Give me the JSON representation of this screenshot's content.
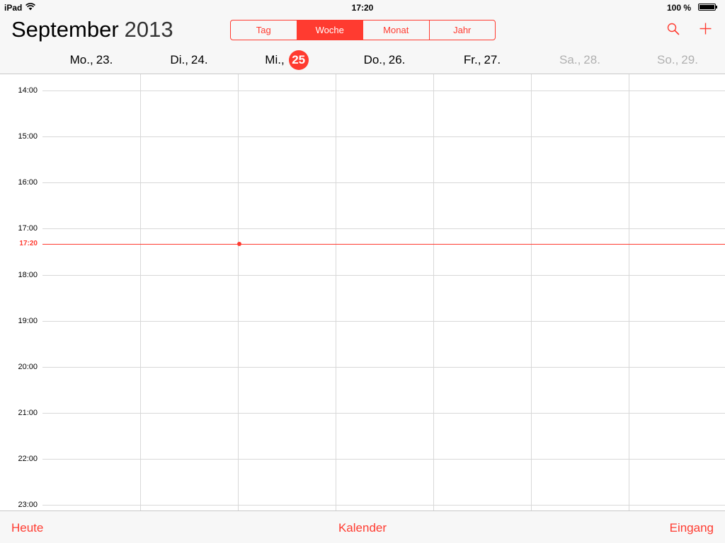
{
  "status_bar": {
    "device": "iPad",
    "time": "17:20",
    "battery": "100 %"
  },
  "header": {
    "month": "September",
    "year": "2013",
    "view_tabs": [
      {
        "label": "Tag",
        "active": false
      },
      {
        "label": "Woche",
        "active": true
      },
      {
        "label": "Monat",
        "active": false
      },
      {
        "label": "Jahr",
        "active": false
      }
    ],
    "search_icon": "search-icon",
    "add_icon": "plus-icon"
  },
  "week": {
    "days": [
      {
        "weekday": "Mo.,",
        "date": "23.",
        "weekend": false,
        "today": false
      },
      {
        "weekday": "Di.,",
        "date": "24.",
        "weekend": false,
        "today": false
      },
      {
        "weekday": "Mi.,",
        "date": "25",
        "weekend": false,
        "today": true
      },
      {
        "weekday": "Do.,",
        "date": "26.",
        "weekend": false,
        "today": false
      },
      {
        "weekday": "Fr.,",
        "date": "27.",
        "weekend": false,
        "today": false
      },
      {
        "weekday": "Sa.,",
        "date": "28.",
        "weekend": true,
        "today": false
      },
      {
        "weekday": "So.,",
        "date": "29.",
        "weekend": true,
        "today": false
      }
    ],
    "hours": [
      "14:00",
      "15:00",
      "16:00",
      "17:00",
      "18:00",
      "19:00",
      "20:00",
      "21:00",
      "22:00",
      "23:00"
    ],
    "current_time": "17:20"
  },
  "toolbar": {
    "today_label": "Heute",
    "calendars_label": "Kalender",
    "inbox_label": "Eingang"
  },
  "colors": {
    "accent": "#ff3b30",
    "weekend_text": "#b0b0b0",
    "grid_line": "#d8d8d8"
  }
}
